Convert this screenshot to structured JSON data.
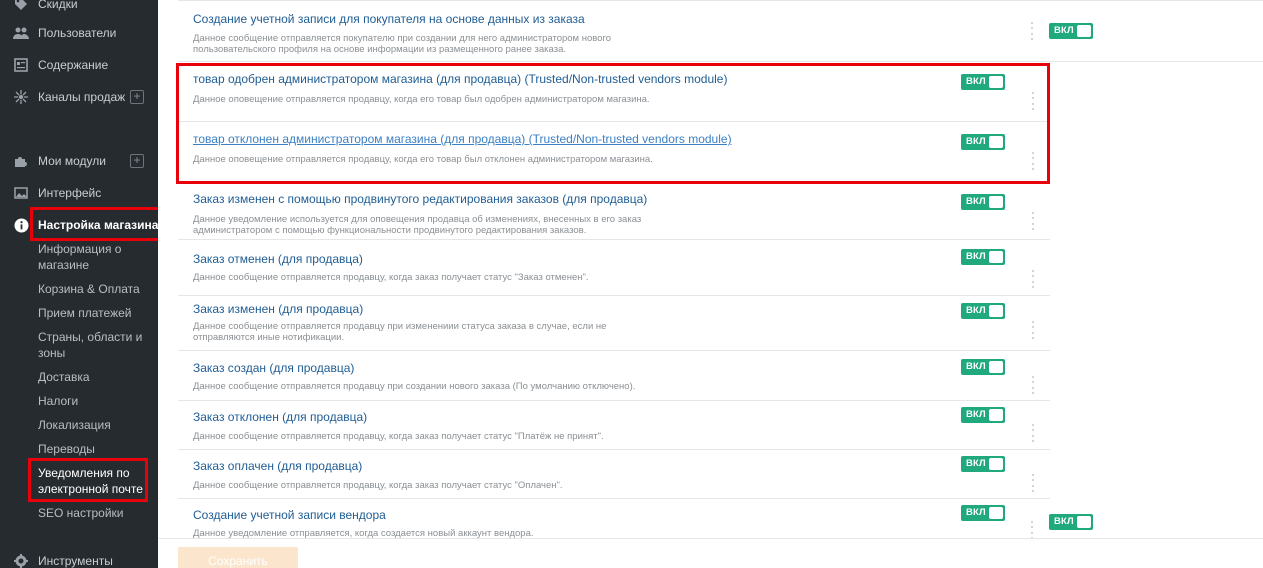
{
  "sidebar": {
    "nav": [
      {
        "label": "Скидки",
        "icon": "tag-icon"
      },
      {
        "label": "Пользователи",
        "icon": "users-icon"
      },
      {
        "label": "Содержание",
        "icon": "content-icon"
      },
      {
        "label": "Каналы продаж",
        "icon": "sales-channels-icon",
        "plus": "+"
      },
      {
        "label": "Мои модули",
        "icon": "puzzle-icon",
        "plus": "+"
      },
      {
        "label": "Интерфейс",
        "icon": "image-icon"
      },
      {
        "label": "Настройка магазина",
        "icon": "info-icon"
      },
      {
        "label": "Инструменты",
        "icon": "gear-icon"
      }
    ],
    "sub_items": [
      "Информация о магазине",
      "Корзина & Оплата",
      "Прием платежей",
      "Страны, области и зоны",
      "Доставка",
      "Налоги",
      "Локализация",
      "Переводы",
      "Уведомления по электронной почте",
      "SEO настройки"
    ]
  },
  "notifications": [
    {
      "title": "Создание учетной записи для покупателя на основе данных из заказа",
      "desc": "Данное сообщение отправляется покупателю при создании для него администратором нового пользовательского профиля на основе информации из размещенного ранее заказа.",
      "toggle": "ВКЛ"
    },
    {
      "title": "товар одобрен администратором магазина (для продавца) (Trusted/Non-trusted vendors module)",
      "desc": "Данное оповещение отправляется продавцу, когда его товар был одобрен администратором магазина.",
      "toggle": "ВКЛ"
    },
    {
      "title": "товар отклонен администратором магазина (для продавца) (Trusted/Non-trusted vendors module)",
      "desc": "Данное оповещение отправляется продавцу, когда его товар был отклонен администратором магазина.",
      "toggle": "ВКЛ"
    },
    {
      "title": "Заказ изменен с помощью продвинутого редактирования заказов (для продавца)",
      "desc": "Данное уведомление используется для оповещения продавца об изменениях, внесенных в его заказ администратором с помощью функциональности продвинутого редактирования заказов.",
      "toggle": "ВКЛ"
    },
    {
      "title": "Заказ отменен (для продавца)",
      "desc": "Данное сообщение отправляется продавцу, когда заказ получает статус \"Заказ отменен\".",
      "toggle": "ВКЛ"
    },
    {
      "title": "Заказ изменен (для продавца)",
      "desc": "Данное сообщение отправляется продавцу при изменениии статуса заказа в случае, если не отправляются иные нотификации.",
      "toggle": "ВКЛ"
    },
    {
      "title": "Заказ создан (для продавца)",
      "desc": "Данное сообщение отправляется продавцу при создании нового заказа (По умолчанию отключено).",
      "toggle": "ВКЛ"
    },
    {
      "title": "Заказ отклонен (для продавца)",
      "desc": "Данное сообщение отправляется продавцу, когда заказ получает статус \"Платёж не принят\".",
      "toggle": "ВКЛ"
    },
    {
      "title": "Заказ оплачен (для продавца)",
      "desc": "Данное сообщение отправляется продавцу, когда заказ получает статус \"Оплачен\".",
      "toggle": "ВКЛ"
    },
    {
      "title": "Создание учетной записи вендора",
      "desc": "Данное уведомление отправляется, когда создается новый аккаунт вендора.",
      "toggle": "ВКЛ"
    }
  ],
  "extra_toggles": [
    "ВКЛ",
    "ВКЛ"
  ],
  "footer": {
    "save_label": "Сохранить"
  },
  "colors": {
    "sidebar_bg": "#262b30",
    "toggle_on": "#1fa97c",
    "highlight_red": "#e8000b",
    "link": "#1f5d94"
  }
}
